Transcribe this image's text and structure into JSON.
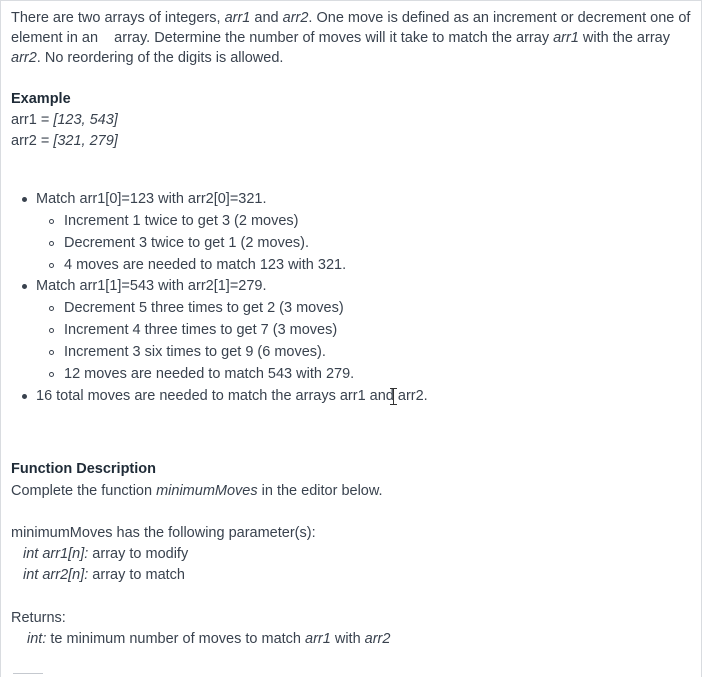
{
  "intro": {
    "p1": "There are two arrays of integers, ",
    "arr1": "arr1",
    "p2": " and ",
    "arr2": "arr2",
    "p3": ". One move is defined as an increment or decrement one of element in an    array. Determine the number of moves will it take to match the array ",
    "arr1b": "arr1",
    "p4": " with the array ",
    "arr2b": "arr2",
    "p5": ". No reordering of the digits is allowed."
  },
  "example": {
    "heading": "Example",
    "line1_prefix": "arr1 = ",
    "line1_value": "[123, 543]",
    "line2_prefix": "arr2 = ",
    "line2_value": "[321, 279]"
  },
  "bullets": {
    "b1": "Match arr1[0]=123 with arr2[0]=321.",
    "b1_sub": [
      "Increment 1 twice to get 3 (2 moves)",
      "Decrement 3 twice to get 1 (2 moves).",
      "4 moves are needed to match 123 with 321."
    ],
    "b2": "Match arr1[1]=543 with arr2[1]=279.",
    "b2_sub": [
      "Decrement 5 three times to get 2 (3 moves)",
      "Increment 4 three times to get 7 (3 moves)",
      "Increment 3 six times to get 9 (6 moves).",
      "12 moves are needed to match 543 with 279."
    ],
    "b3": "16 total moves are needed to match the arrays arr1 and arr2."
  },
  "function_description": {
    "heading": "Function Description",
    "text_prefix": "Complete the function ",
    "func_name": "minimumMoves",
    "text_suffix": " in the editor below."
  },
  "parameters": {
    "intro": "minimumMoves has the following parameter(s):",
    "p1_name": "int arr1[n]:",
    "p1_desc": " array to modify",
    "p2_name": "int arr2[n]:",
    "p2_desc": " array to match"
  },
  "returns": {
    "heading": "Returns:",
    "type": "int:",
    "desc_prefix": " te minimum number of moves to match ",
    "arr1": "arr1",
    "desc_mid": " with ",
    "arr2": "arr2"
  }
}
